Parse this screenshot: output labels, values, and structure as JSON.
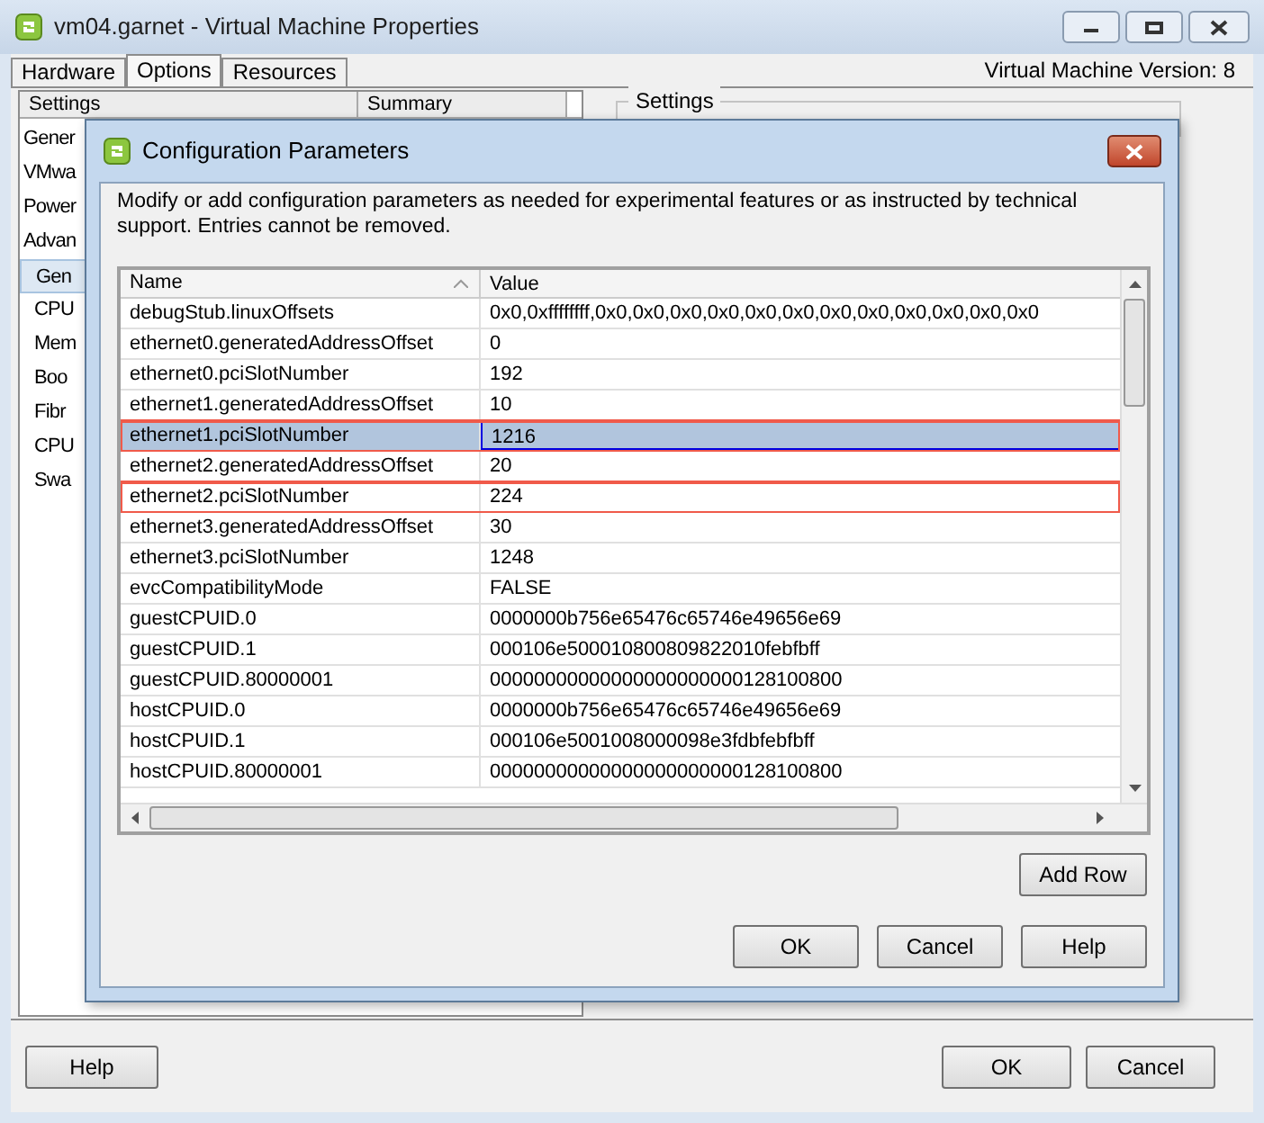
{
  "window": {
    "title": "vm04.garnet - Virtual Machine Properties"
  },
  "tabs": [
    {
      "label": "Hardware",
      "selected": false
    },
    {
      "label": "Options",
      "selected": true
    },
    {
      "label": "Resources",
      "selected": false
    }
  ],
  "version_label": "Virtual Machine Version: 8",
  "settings_list": {
    "columns": [
      "Settings",
      "Summary"
    ],
    "items": [
      {
        "label": "Gener",
        "selected": false
      },
      {
        "label": "VMwa",
        "selected": false
      },
      {
        "label": "Power",
        "selected": false
      },
      {
        "label": "Advan",
        "selected": false,
        "children": [
          {
            "label": "Gen",
            "selected": true
          },
          {
            "label": "CPU",
            "selected": false
          },
          {
            "label": "Mem",
            "selected": false
          },
          {
            "label": "Boo",
            "selected": false
          },
          {
            "label": "Fibr",
            "selected": false
          },
          {
            "label": "CPU",
            "selected": false
          },
          {
            "label": "Swa",
            "selected": false
          }
        ]
      }
    ]
  },
  "settings_group": {
    "title": "Settings"
  },
  "dialog": {
    "title": "Configuration Parameters",
    "description": "Modify or add configuration parameters as needed for experimental features or as instructed by technical support. Entries cannot be removed.",
    "table": {
      "columns": [
        "Name",
        "Value"
      ],
      "rows": [
        {
          "name": "debugStub.linuxOffsets",
          "value": "0x0,0xffffffff,0x0,0x0,0x0,0x0,0x0,0x0,0x0,0x0,0x0,0x0,0x0,0x0",
          "selected": false,
          "outlined": false
        },
        {
          "name": "ethernet0.generatedAddressOffset",
          "value": "0",
          "selected": false,
          "outlined": false
        },
        {
          "name": "ethernet0.pciSlotNumber",
          "value": "192",
          "selected": false,
          "outlined": false
        },
        {
          "name": "ethernet1.generatedAddressOffset",
          "value": "10",
          "selected": false,
          "outlined": false
        },
        {
          "name": "ethernet1.pciSlotNumber",
          "value": "1216",
          "selected": true,
          "outlined": true
        },
        {
          "name": "ethernet2.generatedAddressOffset",
          "value": "20",
          "selected": false,
          "outlined": false
        },
        {
          "name": "ethernet2.pciSlotNumber",
          "value": "224",
          "selected": false,
          "outlined": true
        },
        {
          "name": "ethernet3.generatedAddressOffset",
          "value": "30",
          "selected": false,
          "outlined": false
        },
        {
          "name": "ethernet3.pciSlotNumber",
          "value": "1248",
          "selected": false,
          "outlined": false
        },
        {
          "name": "evcCompatibilityMode",
          "value": "FALSE",
          "selected": false,
          "outlined": false
        },
        {
          "name": "guestCPUID.0",
          "value": "0000000b756e65476c65746e49656e69",
          "selected": false,
          "outlined": false
        },
        {
          "name": "guestCPUID.1",
          "value": "000106e500010800809822010febfbff",
          "selected": false,
          "outlined": false
        },
        {
          "name": "guestCPUID.80000001",
          "value": "00000000000000000000000128100800",
          "selected": false,
          "outlined": false
        },
        {
          "name": "hostCPUID.0",
          "value": "0000000b756e65476c65746e49656e69",
          "selected": false,
          "outlined": false
        },
        {
          "name": "hostCPUID.1",
          "value": "000106e5001008000098e3fdbfebfbff",
          "selected": false,
          "outlined": false
        },
        {
          "name": "hostCPUID.80000001",
          "value": "00000000000000000000000128100800",
          "selected": false,
          "outlined": false
        }
      ]
    },
    "add_button": "Add Row",
    "buttons": [
      "OK",
      "Cancel",
      "Help"
    ]
  },
  "footer": {
    "left_button": "Help",
    "right_buttons": [
      "OK",
      "Cancel"
    ]
  }
}
